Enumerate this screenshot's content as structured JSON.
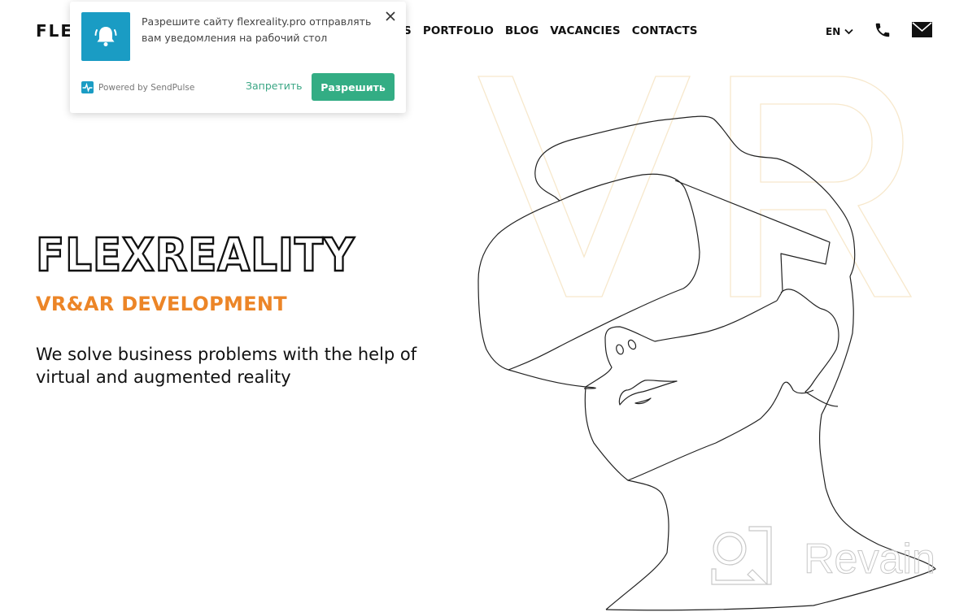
{
  "header": {
    "logo": "FLE",
    "nav": [
      {
        "label": "S"
      },
      {
        "label": "PORTFOLIO"
      },
      {
        "label": "BLOG"
      },
      {
        "label": "VACANCIES"
      },
      {
        "label": "CONTACTS"
      }
    ],
    "language": "EN",
    "icons": {
      "phone": "phone-icon",
      "mail": "mail-icon",
      "language_dropdown": "chevron-down-icon"
    }
  },
  "notification": {
    "message": "Разрешите сайту flexreality.pro отправлять вам уведомления на рабочий стол",
    "powered_by": "Powered by SendPulse",
    "deny_label": "Запретить",
    "allow_label": "Разрешить",
    "icon": "bell-icon",
    "colors": {
      "icon_bg": "#1a9cc4",
      "allow_bg": "#33ad84",
      "deny_text": "#3aa684"
    }
  },
  "hero": {
    "title": "FLEXREALITY",
    "subtitle": "VR&AR DEVELOPMENT",
    "description": "We solve business problems with the help of virtual and augmented reality",
    "accent_color": "#ec8527",
    "background_letters": "VR"
  },
  "watermark": {
    "text": "Revain"
  }
}
